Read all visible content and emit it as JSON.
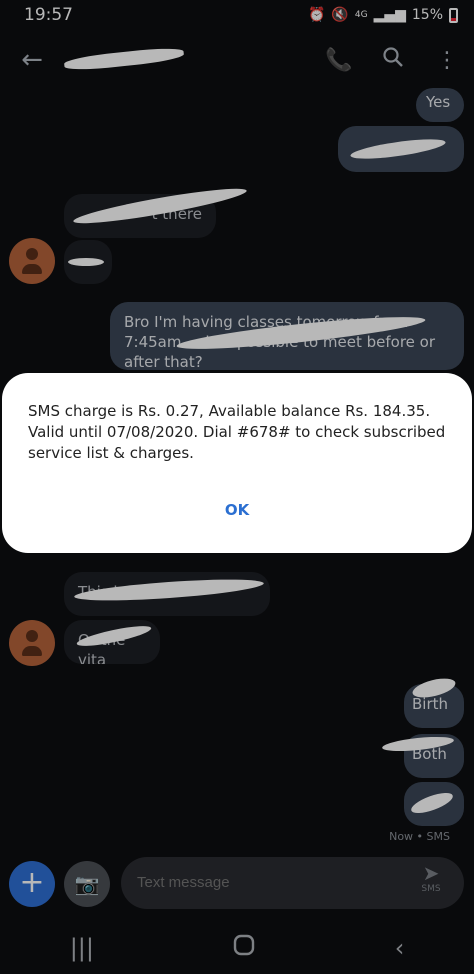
{
  "status_bar": {
    "time": "19:57",
    "battery": "15%",
    "network": "4G"
  },
  "conversation": {
    "contact_name": ""
  },
  "messages": [
    {
      "dir": "out",
      "text": "Yes"
    },
    {
      "dir": "out",
      "text": ""
    },
    {
      "dir": "in",
      "text": "t there"
    },
    {
      "dir": "in",
      "text": ""
    },
    {
      "dir": "out",
      "text": "Bro I'm having classes tomorrow from 7:45am ... is it possible to meet before or after that?"
    },
    {
      "dir": "in",
      "text": "This is ... mah"
    },
    {
      "dir": "in",
      "text": "Or the vita"
    },
    {
      "dir": "out",
      "text": "Birth"
    },
    {
      "dir": "out",
      "text": "Both"
    },
    {
      "dir": "out",
      "text": ""
    }
  ],
  "last_status": "Now • SMS",
  "dialog": {
    "message": "SMS charge is Rs. 0.27, Available balance Rs. 184.35. Valid until 07/08/2020. Dial #678# to check subscribed service list & charges.",
    "ok_label": "OK"
  },
  "composer": {
    "placeholder": "Text message",
    "send_label": "SMS"
  },
  "icons": {
    "back": "arrow-left-icon",
    "call": "phone-icon",
    "search": "search-icon",
    "menu": "more-vert-icon"
  },
  "colors": {
    "accent": "#2b6fd1",
    "outgoing": "#3b4656",
    "incoming": "#1d1f24"
  }
}
